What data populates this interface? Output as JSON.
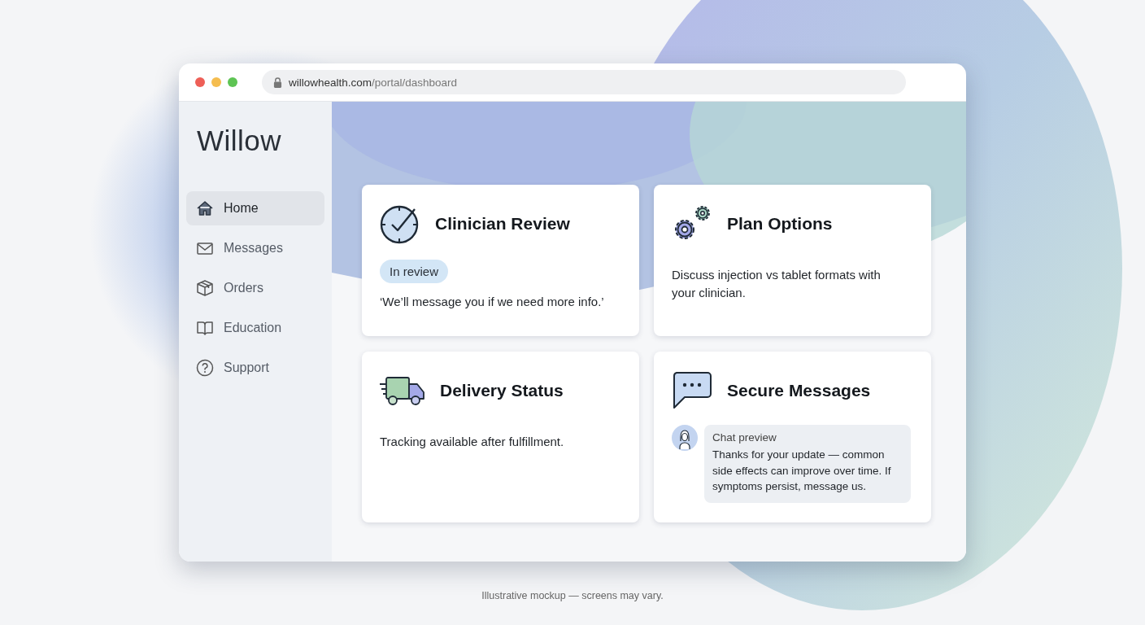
{
  "browser": {
    "url_domain": "willowhealth.com",
    "url_path": "/portal/dashboard"
  },
  "sidebar": {
    "logo": "Willow",
    "items": [
      {
        "label": "Home",
        "selected": true
      },
      {
        "label": "Messages",
        "selected": false
      },
      {
        "label": "Orders",
        "selected": false
      },
      {
        "label": "Education",
        "selected": false
      },
      {
        "label": "Support",
        "selected": false
      }
    ]
  },
  "cards": [
    {
      "kind": "status",
      "title": "Clinician Review",
      "badge": "In review",
      "text": "‘We’ll message you if we need more info.’"
    },
    {
      "kind": "text",
      "title": "Plan Options",
      "text": "Discuss injection vs tablet formats with your clinician."
    },
    {
      "kind": "text",
      "title": "Delivery Status",
      "text": "Tracking available after fulfillment."
    },
    {
      "kind": "chat",
      "title": "Secure Messages",
      "chat_label": "Chat preview",
      "text": "Thanks for your update — common side effects can improve over time. If symptoms persist, message us."
    }
  ],
  "caption": "Illustrative mockup — screens may vary."
}
